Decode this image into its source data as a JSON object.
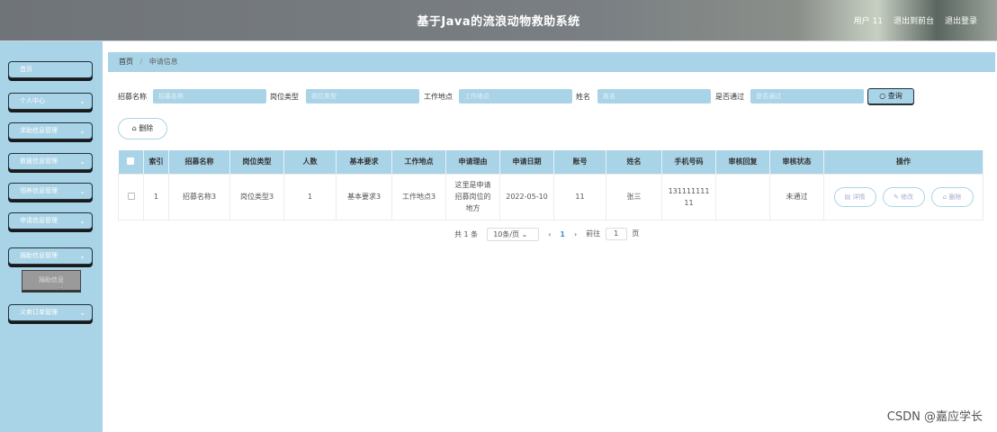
{
  "header": {
    "title": "基于Java的流浪动物救助系统",
    "user": "用户 11",
    "front": "退出到前台",
    "logout": "退出登录"
  },
  "sidebar": {
    "items": [
      {
        "label": "首页",
        "chevron": false
      },
      {
        "label": "个人中心",
        "chevron": true
      },
      {
        "label": "求助信息管理",
        "chevron": true
      },
      {
        "label": "救援信息管理",
        "chevron": true
      },
      {
        "label": "领养信息管理",
        "chevron": true
      },
      {
        "label": "申请信息管理",
        "chevron": true
      },
      {
        "label": "捐助信息管理",
        "chevron": true
      },
      {
        "label": "义卖订单管理",
        "chevron": true
      }
    ],
    "submenu": "捐助信息"
  },
  "breadcrumb": {
    "home": "首页",
    "separator": "/",
    "current": "申请信息"
  },
  "filters": [
    {
      "label": "招募名称",
      "placeholder": "招募名称"
    },
    {
      "label": "岗位类型",
      "placeholder": "岗位类型"
    },
    {
      "label": "工作地点",
      "placeholder": "工作地点"
    },
    {
      "label": "姓名",
      "placeholder": "姓名"
    },
    {
      "label": "是否通过",
      "placeholder": "是否通过"
    }
  ],
  "query_label": "查询",
  "delete_label": "删除",
  "table": {
    "headers": [
      "索引",
      "招募名称",
      "岗位类型",
      "人数",
      "基本要求",
      "工作地点",
      "申请理由",
      "申请日期",
      "账号",
      "姓名",
      "手机号码",
      "审核回复",
      "审核状态",
      "操作"
    ],
    "rows": [
      [
        "1",
        "招募名称3",
        "岗位类型3",
        "1",
        "基本要求3",
        "工作地点3",
        "这里是申请招募岗位的地方",
        "2022-05-10",
        "11",
        "张三",
        "13111111111",
        "",
        "未通过"
      ]
    ],
    "actions": [
      "详情",
      "修改",
      "删除"
    ]
  },
  "pager": {
    "total": "共 1 条",
    "size": "10条/页",
    "prev": "‹",
    "page": "1",
    "next": "›",
    "goto": "前往",
    "goto_value": "1",
    "unit": "页"
  },
  "watermark": "CSDN @嘉应学长",
  "icons": {
    "search": "search-icon",
    "trash": "trash-icon",
    "doc": "document-icon",
    "edit": "edit-icon"
  }
}
